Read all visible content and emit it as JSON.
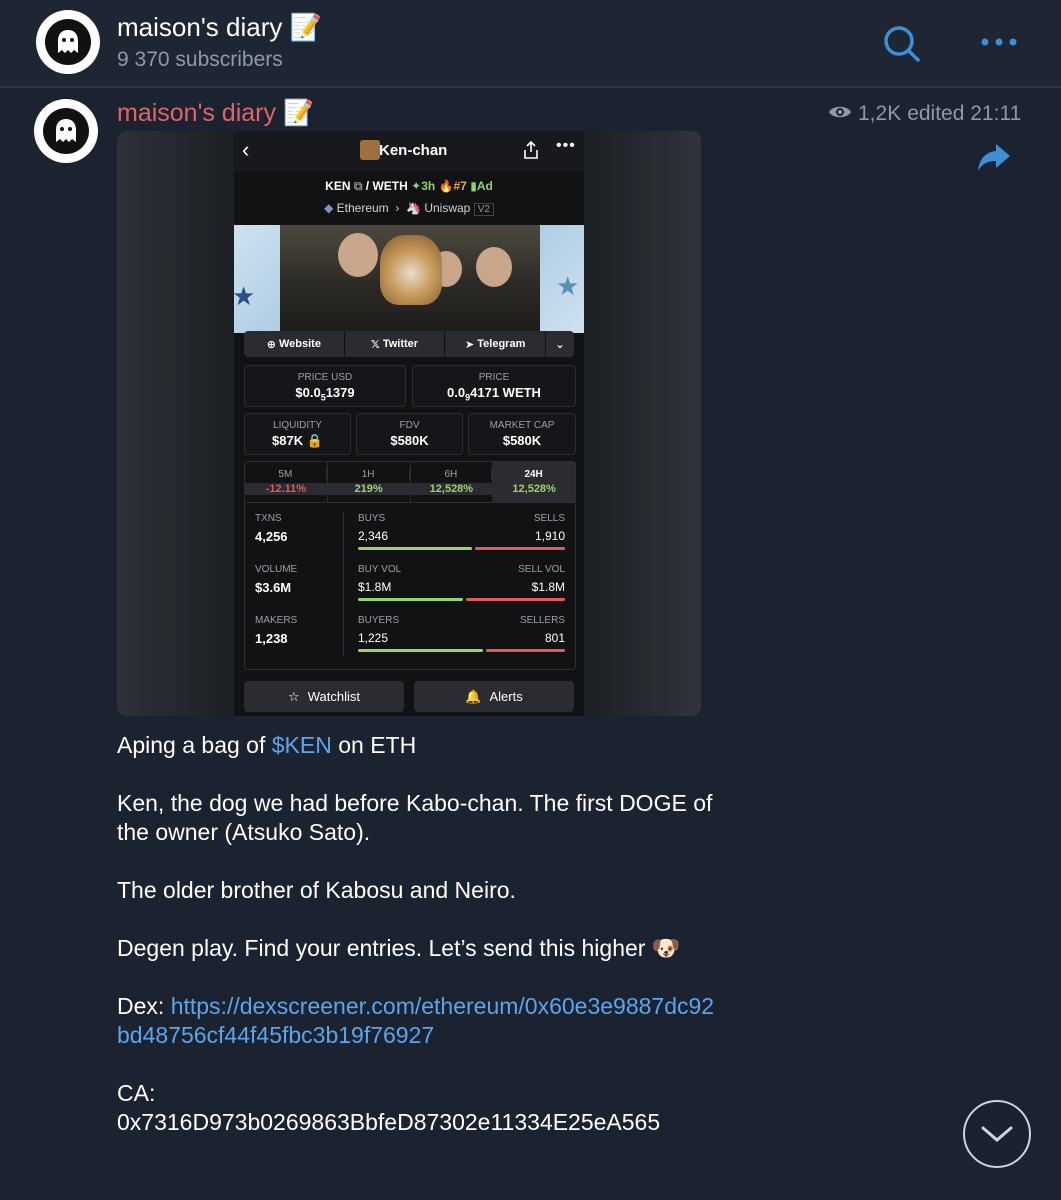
{
  "header": {
    "channel_name": "maison's diary 📝",
    "subscribers": "9 370 subscribers"
  },
  "message": {
    "author": "maison's diary 📝",
    "views": "1,2K",
    "edited": "edited 21:11",
    "screenshot": {
      "title": "Ken-chan",
      "pair_base": "KEN",
      "pair_quote": "/ WETH",
      "badge_age": "3h",
      "badge_rank": "#7",
      "badge_ad": "Ad",
      "chain": "Ethereum",
      "dex": "Uniswap",
      "dex_version": "V2",
      "links": [
        "Website",
        "Twitter",
        "Telegram"
      ],
      "price_usd_label": "PRICE USD",
      "price_usd_main": "$0.0",
      "price_usd_sub": "5",
      "price_usd_rest": "1379",
      "price_label": "PRICE",
      "price_main": "0.0",
      "price_sub": "9",
      "price_rest": "4171 WETH",
      "liquidity_label": "LIQUIDITY",
      "liquidity": "$87K",
      "fdv_label": "FDV",
      "fdv": "$580K",
      "mcap_label": "MARKET CAP",
      "mcap": "$580K",
      "tabs": [
        {
          "label": "5M",
          "value": "-12.11%",
          "color": "#e25a5a"
        },
        {
          "label": "1H",
          "value": "219%",
          "color": "#9bd36b"
        },
        {
          "label": "6H",
          "value": "12,528%",
          "color": "#9bd36b"
        },
        {
          "label": "24H",
          "value": "12,528%",
          "color": "#9bd36b"
        }
      ],
      "txns_label": "TXNS",
      "txns": "4,256",
      "buys_label": "BUYS",
      "buys": "2,346",
      "sells_label": "SELLS",
      "sells": "1,910",
      "volume_label": "VOLUME",
      "volume": "$3.6M",
      "buyvol_label": "BUY VOL",
      "buyvol": "$1.8M",
      "sellvol_label": "SELL VOL",
      "sellvol": "$1.8M",
      "makers_label": "MAKERS",
      "makers": "1,238",
      "buyers_label": "BUYERS",
      "buyers": "1,225",
      "sellers_label": "SELLERS",
      "sellers": "801",
      "watchlist": "Watchlist",
      "alerts": "Alerts"
    },
    "text": {
      "line1_pre": "Aping a bag of ",
      "line1_ticker": "$KEN",
      "line1_post": " on ETH",
      "para2": "Ken, the dog we had before Kabo-chan. The first DOGE of the owner (Atsuko Sato).",
      "para3": "The older brother of Kabosu and Neiro.",
      "para4": "Degen play. Find your entries. Let’s send this higher 🐶",
      "dex_label": "Dex: ",
      "dex_link": "https://dexscreener.com/ethereum/0x60e3e9887dc92bd48756cf44f45fbc3b19f76927",
      "ca_label": "CA:",
      "ca": "0x7316D973b0269863BbfeD87302e11334E25eA565"
    }
  },
  "colors": {
    "background": "#1b2230",
    "accent": "#3d8fd6",
    "author": "#e0646a",
    "link": "#5aa5ec"
  }
}
